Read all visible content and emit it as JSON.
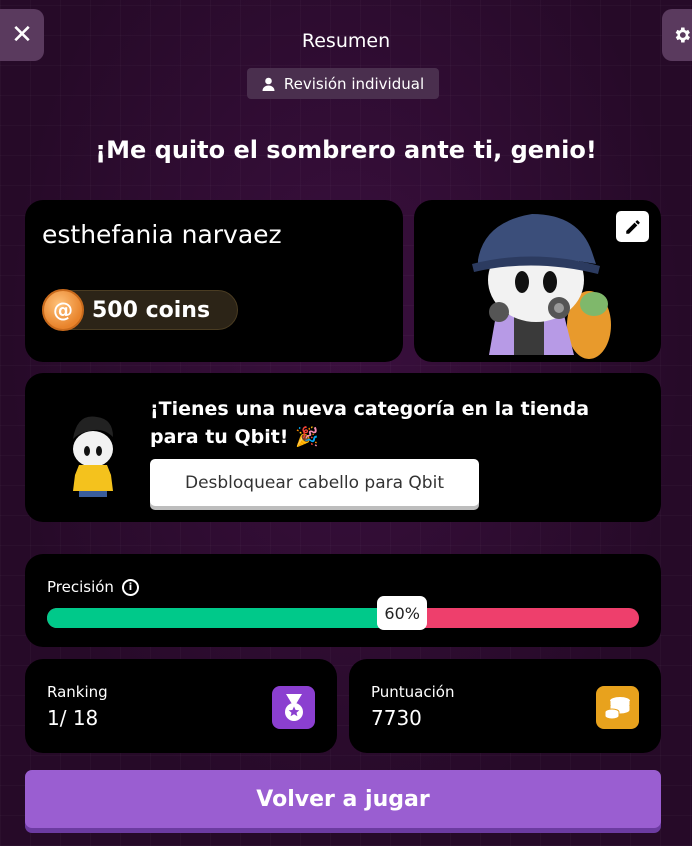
{
  "header": {
    "close_glyph": "✕",
    "title": "Resumen",
    "review_label": "Revisión individual",
    "headline": "¡Me quito el sombrero ante ti, genio!"
  },
  "player": {
    "name": "esthefania narvaez",
    "coins_text": "500 coins"
  },
  "unlock": {
    "message": "¡Tienes una nueva categoría en la tienda para tu Qbit! 🎉",
    "button_label": "Desbloquear cabello para Qbit"
  },
  "precision": {
    "label": "Precisión",
    "value_percent": 60,
    "value_label": "60%"
  },
  "ranking": {
    "label": "Ranking",
    "value": "1/ 18"
  },
  "score": {
    "label": "Puntuación",
    "value": "7730"
  },
  "actions": {
    "play_again_label": "Volver a jugar"
  },
  "colors": {
    "correct": "#00c98a",
    "incorrect": "#ee3f6c",
    "primary": "#9a5ed1",
    "ranking_icon": "#8b3fd0",
    "score_icon": "#e8a21d"
  },
  "icons": [
    "close-icon",
    "gear-icon",
    "user-icon",
    "coin-icon",
    "pencil-icon",
    "info-icon",
    "medal-icon",
    "coins-stack-icon"
  ]
}
